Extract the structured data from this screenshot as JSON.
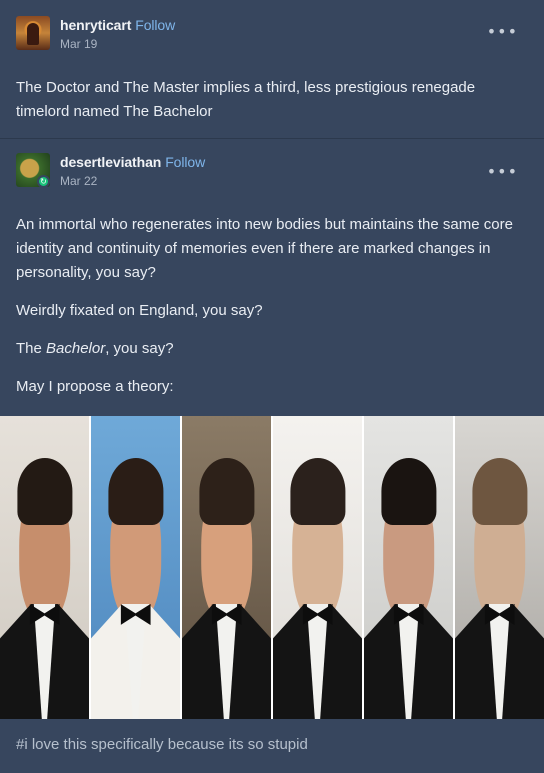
{
  "posts": [
    {
      "username": "henryticart",
      "follow_label": "Follow",
      "date": "Mar 19",
      "menu_icon": "more-icon",
      "text": "The Doctor and The Master implies a third, less prestigious renegade timelord named The Bachelor"
    },
    {
      "username": "desertleviathan",
      "follow_label": "Follow",
      "date": "Mar 22",
      "menu_icon": "more-icon",
      "paragraphs": [
        "An immortal who regenerates into new bodies but maintains the same core identity and continuity of memories even if there are marked changes in personality, you say?",
        "Weirdly fixated on England, you say?"
      ],
      "bachelor_line": {
        "prefix": "The ",
        "emphasis": "Bachelor",
        "suffix": ", you say?"
      },
      "theory_line": "May I propose a theory:",
      "tags": "#i love this specifically because its so stupid"
    }
  ],
  "colors": {
    "background": "#37465e",
    "follow": "#7fb5ea",
    "reblog": "#19c37a"
  }
}
